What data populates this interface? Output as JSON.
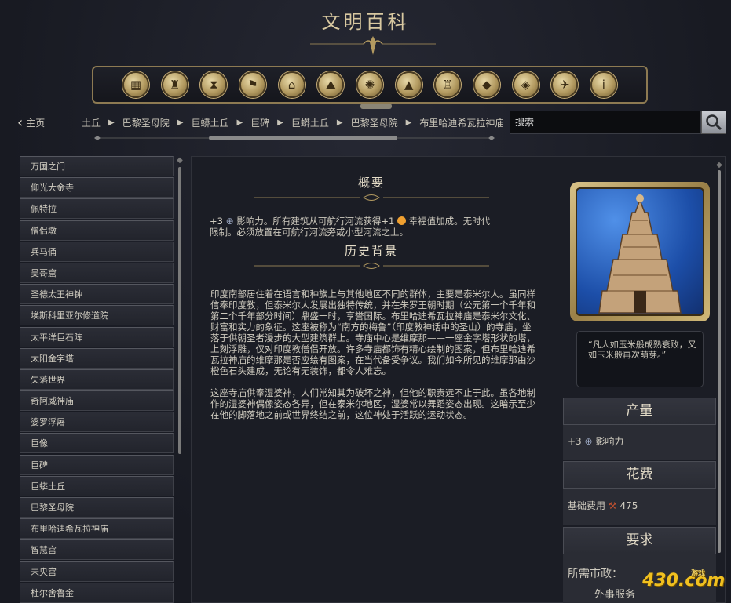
{
  "header": {
    "title": "文明百科"
  },
  "toolbar": {
    "buttons": [
      {
        "icon": "resource-icon",
        "glyph": "▦"
      },
      {
        "icon": "trophy-icon",
        "glyph": "♜"
      },
      {
        "icon": "hourglass-icon",
        "glyph": "⧗"
      },
      {
        "icon": "flag-icon",
        "glyph": "⚑"
      },
      {
        "icon": "government-icon",
        "glyph": "⌂"
      },
      {
        "icon": "terrain-icon",
        "glyph": "⛰"
      },
      {
        "icon": "unit-icon",
        "glyph": "✺"
      },
      {
        "icon": "mountain-icon",
        "glyph": "▲"
      },
      {
        "icon": "city-icon",
        "glyph": "♖"
      },
      {
        "icon": "diamond-icon",
        "glyph": "◆"
      },
      {
        "icon": "wonder-icon",
        "glyph": "◈"
      },
      {
        "icon": "dove-icon",
        "glyph": "✈"
      },
      {
        "icon": "info-icon",
        "glyph": "i"
      }
    ]
  },
  "nav": {
    "home_label": "主页"
  },
  "breadcrumb": {
    "first_partial": "巨蟒土丘",
    "items": [
      "巴黎圣母院",
      "巨蟒土丘",
      "巨碑",
      "巨蟒土丘",
      "巴黎圣母院",
      "布里哈迪希瓦拉神庙"
    ]
  },
  "search": {
    "placeholder": "搜索"
  },
  "sidebar": {
    "items": [
      "万国之门",
      "仰光大金寺",
      "佩特拉",
      "僧侣墩",
      "兵马俑",
      "吴哥窟",
      "圣德太王神钟",
      "埃斯科里亚尔修道院",
      "太平洋巨石阵",
      "太阳金字塔",
      "失落世界",
      "奇阿威神庙",
      "婆罗浮屠",
      "巨像",
      "巨碑",
      "巨蟒土丘",
      "巴黎圣母院",
      "布里哈迪希瓦拉神庙",
      "智慧宫",
      "未央宫",
      "杜尔舍鲁金"
    ]
  },
  "article": {
    "overview_title": "概要",
    "overview_lines": {
      "l1a": "+3",
      "l1b": "影响力。所有建筑从可航行河流获得+1",
      "l1c": "幸福值加成。无时代",
      "l2": "限制。必须放置在可航行河流旁或小型河流之上。"
    },
    "history_title": "历史背景",
    "history_p1": "印度南部居住着在语言和种族上与其他地区不同的群体，主要是泰米尔人。虽同样信奉印度教，但泰米尔人发展出独特传统，并在朱罗王朝时期（公元第一个千年和第二个千年部分时间）鼎盛一时，享誉国际。布里哈迪希瓦拉神庙是泰米尔文化、财富和实力的象征。这座被称为“南方的梅鲁”（印度教神话中的圣山）的寺庙，坐落于供朝圣者漫步的大型建筑群上。寺庙中心是维摩那——一座金字塔形状的塔，上刻浮雕，仅对印度教僧侣开放。许多寺庙都饰有精心绘制的图案，但布里哈迪希瓦拉神庙的维摩那是否应绘有图案，在当代备受争议。我们如今所见的维摩那由沙橙色石头建成，无论有无装饰，都令人难忘。",
    "history_p2": "这座寺庙供奉湿婆神，人们常知其为破坏之神，但他的职责远不止于此。虽各地制作的湿婆神偶像姿态各异，但在泰米尔地区，湿婆常以舞蹈姿态出现。这暗示至少在他的脚落地之前或世界终结之前，这位神处于活跃的运动状态。"
  },
  "details": {
    "quote": "“凡人如玉米般成熟衰败，又如玉米般再次萌芽。”",
    "output_title": "产量",
    "output_value": "+3",
    "output_label": "影响力",
    "cost_title": "花费",
    "cost_label": "基础费用",
    "cost_value": "475",
    "req_title": "要求",
    "req_label": "所需市政：",
    "req_value": "外事服务"
  },
  "watermark": {
    "main": "430.com",
    "small": "游戏"
  },
  "colors": {
    "gold": "#b39a60",
    "accent_text": "#e4dcc8",
    "panel_bg": "#1b1d25"
  }
}
